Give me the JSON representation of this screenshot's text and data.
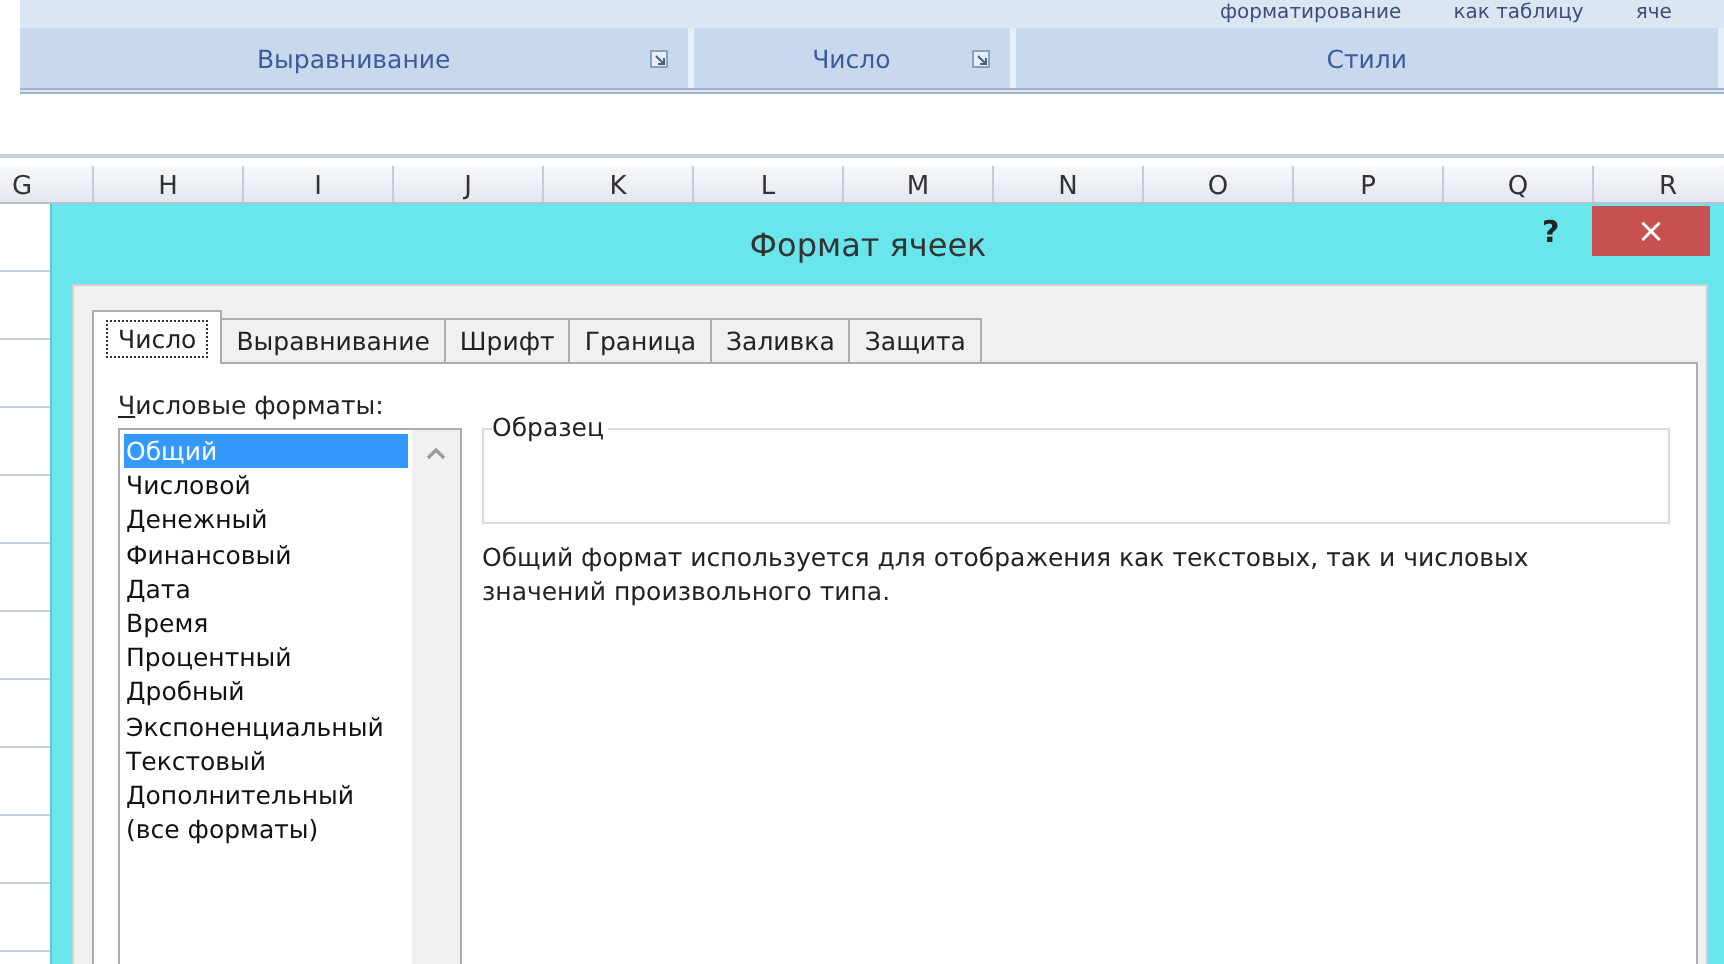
{
  "ribbon": {
    "cut_texts": [
      "форматирование",
      "как таблицу",
      "яче"
    ],
    "groups": [
      {
        "label": "Выравнивание",
        "launcher": true
      },
      {
        "label": "Число",
        "launcher": true
      },
      {
        "label": "Стили",
        "launcher": false
      }
    ]
  },
  "columns": [
    "G",
    "H",
    "I",
    "J",
    "K",
    "L",
    "M",
    "N",
    "O",
    "P",
    "Q",
    "R"
  ],
  "dialog": {
    "title": "Формат ячеек",
    "help": "?",
    "close": "×",
    "tabs": [
      {
        "label": "Число",
        "selected": true
      },
      {
        "label": "Выравнивание",
        "selected": false
      },
      {
        "label": "Шрифт",
        "selected": false
      },
      {
        "label": "Граница",
        "selected": false
      },
      {
        "label": "Заливка",
        "selected": false
      },
      {
        "label": "Защита",
        "selected": false
      }
    ],
    "formats_label": {
      "accel": "Ч",
      "rest": "исловые форматы:"
    },
    "formats": [
      {
        "label": "Общий",
        "selected": true
      },
      {
        "label": "Числовой",
        "selected": false
      },
      {
        "label": "Денежный",
        "selected": false
      },
      {
        "label": "Финансовый",
        "selected": false
      },
      {
        "label": "Дата",
        "selected": false
      },
      {
        "label": "Время",
        "selected": false
      },
      {
        "label": "Процентный",
        "selected": false
      },
      {
        "label": "Дробный",
        "selected": false
      },
      {
        "label": "Экспоненциальный",
        "selected": false
      },
      {
        "label": "Текстовый",
        "selected": false
      },
      {
        "label": "Дополнительный",
        "selected": false
      },
      {
        "label": "(все форматы)",
        "selected": false
      }
    ],
    "sample_label": "Образец",
    "description": "Общий формат используется для отображения как текстовых, так и числовых значений произвольного типа."
  }
}
